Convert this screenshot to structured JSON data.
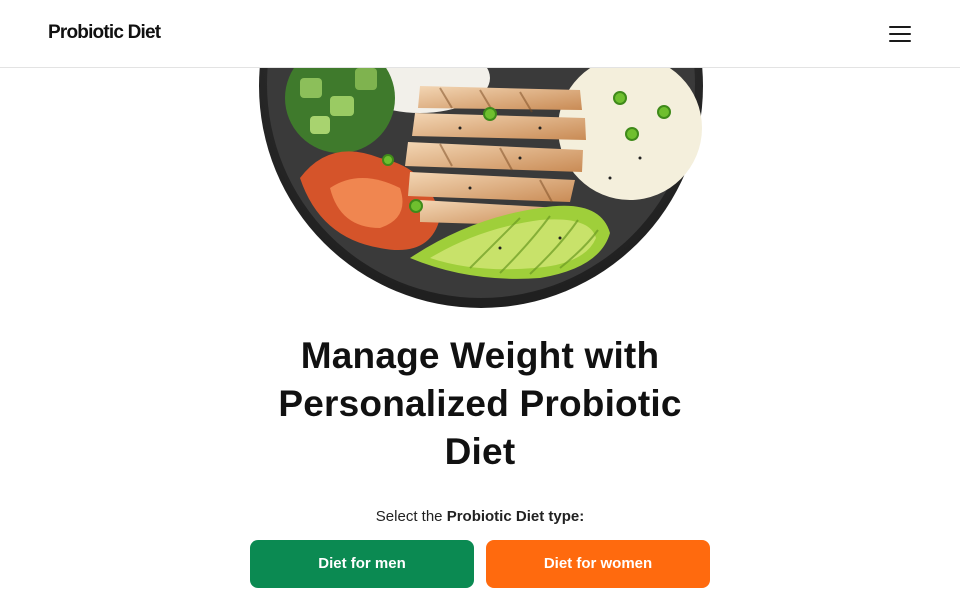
{
  "header": {
    "logo": "Probiotic Diet",
    "menu_icon": "hamburger-menu-icon"
  },
  "hero": {
    "image": "bowl with sliced grilled chicken, rice, cucumber salad, kimchi and avocado"
  },
  "main": {
    "title_lines": [
      "Manage Weight with",
      "Personalized Probiotic",
      "Diet"
    ],
    "subtitle_prefix": "Select the ",
    "subtitle_bold": "Probiotic Diet type:",
    "buttons": {
      "men": "Diet for men",
      "women": "Diet for women"
    }
  },
  "colors": {
    "men_button": "#0b8a52",
    "women_button": "#ff6a0e",
    "text": "#111111"
  }
}
